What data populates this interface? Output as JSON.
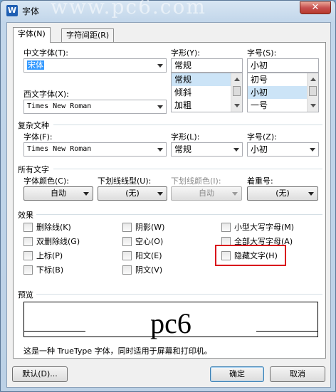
{
  "window": {
    "title": "字体",
    "watermark": "www.pc6.com",
    "app_icon": "W",
    "close_symbol": "✕"
  },
  "tabs": [
    {
      "label": "字体(N)"
    },
    {
      "label": "字符间距(R)"
    }
  ],
  "chinese_font": {
    "label": "中文字体(T):",
    "value": "宋体"
  },
  "western_font": {
    "label": "西文字体(X):",
    "value": "Times New Roman"
  },
  "style": {
    "label": "字形(Y):",
    "value": "常规",
    "items": [
      "常规",
      "倾斜",
      "加粗"
    ]
  },
  "size": {
    "label": "字号(S):",
    "value": "小初",
    "items": [
      "初号",
      "小初",
      "一号"
    ]
  },
  "complex": {
    "group": "复杂文种",
    "font_label": "字体(F):",
    "font_value": "Times New Roman",
    "style_label": "字形(L):",
    "style_value": "常规",
    "size_label": "字号(Z):",
    "size_value": "小初"
  },
  "all_text": {
    "group": "所有文字",
    "color_label": "字体颜色(C):",
    "color_value": "自动",
    "underline_label": "下划线线型(U):",
    "underline_value": "(无)",
    "underline_color_label": "下划线颜色(I):",
    "underline_color_value": "自动",
    "emphasis_label": "着重号:",
    "emphasis_value": "(无)"
  },
  "effects": {
    "group": "效果",
    "strike": "删除线(K)",
    "double_strike": "双删除线(G)",
    "superscript": "上标(P)",
    "subscript": "下标(B)",
    "shadow": "阴影(W)",
    "outline": "空心(O)",
    "emboss": "阳文(E)",
    "engrave": "阴文(V)",
    "small_caps": "小型大写字母(M)",
    "all_caps": "全部大写字母(A)",
    "hidden": "隐藏文字(H)"
  },
  "preview": {
    "group": "预览",
    "sample": "pc6",
    "description": "这是一种 TrueType 字体，同时适用于屏幕和打印机。"
  },
  "buttons": {
    "default": "默认(D)...",
    "ok": "确定",
    "cancel": "取消"
  }
}
